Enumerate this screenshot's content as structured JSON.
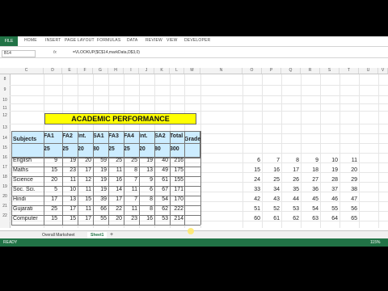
{
  "ribbon": {
    "file": "FILE",
    "tabs": [
      "HOME",
      "INSERT",
      "PAGE LAYOUT",
      "FORMULAS",
      "DATA",
      "REVIEW",
      "VIEW",
      "DEVELOPER"
    ]
  },
  "formula_bar": {
    "name_box": "B14",
    "fx": "fx",
    "formula": "=VLOOKUP($C$14,markData,D$3,0)"
  },
  "columns": [
    "C",
    "D",
    "E",
    "F",
    "G",
    "H",
    "I",
    "J",
    "K",
    "L",
    "M",
    "N",
    "O",
    "P",
    "Q",
    "R",
    "S",
    "T",
    "U",
    "V",
    "W"
  ],
  "rows": [
    "8",
    "9",
    "10",
    "11",
    "12",
    "13",
    "14",
    "15",
    "16",
    "17",
    "18",
    "19",
    "20",
    "21",
    "22"
  ],
  "sheet": {
    "title": "ACADEMIC PERFORMANCE",
    "subjects_header": "Subjects",
    "grade_header": "Grade",
    "test_headers": [
      "FA1",
      "FA2",
      "Int.",
      "SA1",
      "FA3",
      "FA4",
      "Int.",
      "SA2",
      "Total"
    ],
    "max_marks": [
      "25",
      "25",
      "20",
      "80",
      "25",
      "25",
      "20",
      "80",
      "300"
    ],
    "rows": [
      {
        "subject": "English",
        "marks": [
          "9",
          "19",
          "20",
          "59",
          "25",
          "25",
          "19",
          "40",
          "216"
        ]
      },
      {
        "subject": "Maths",
        "marks": [
          "15",
          "23",
          "17",
          "19",
          "11",
          "8",
          "13",
          "49",
          "175"
        ]
      },
      {
        "subject": "Science",
        "marks": [
          "20",
          "11",
          "12",
          "19",
          "16",
          "7",
          "9",
          "61",
          "155"
        ]
      },
      {
        "subject": "Soc. Sci.",
        "marks": [
          "5",
          "10",
          "11",
          "19",
          "14",
          "11",
          "6",
          "67",
          "171"
        ]
      },
      {
        "subject": "Hindi",
        "marks": [
          "17",
          "13",
          "15",
          "39",
          "17",
          "7",
          "8",
          "54",
          "170"
        ]
      },
      {
        "subject": "Gujarati",
        "marks": [
          "25",
          "17",
          "11",
          "66",
          "22",
          "11",
          "8",
          "62",
          "222"
        ]
      },
      {
        "subject": "Computer",
        "marks": [
          "15",
          "15",
          "17",
          "55",
          "20",
          "23",
          "16",
          "53",
          "214"
        ]
      }
    ],
    "side_numbers": [
      [
        "6",
        "7",
        "8",
        "9",
        "10",
        "11"
      ],
      [
        "15",
        "16",
        "17",
        "18",
        "19",
        "20"
      ],
      [
        "24",
        "25",
        "26",
        "27",
        "28",
        "29"
      ],
      [
        "33",
        "34",
        "35",
        "36",
        "37",
        "38"
      ],
      [
        "42",
        "43",
        "44",
        "45",
        "46",
        "47"
      ],
      [
        "51",
        "52",
        "53",
        "54",
        "55",
        "56"
      ],
      [
        "60",
        "61",
        "62",
        "63",
        "64",
        "65"
      ]
    ]
  },
  "sheet_tabs": [
    "Overall Marksheet",
    "Sheet1"
  ],
  "status": {
    "left": "READY",
    "zoom": "115%"
  }
}
